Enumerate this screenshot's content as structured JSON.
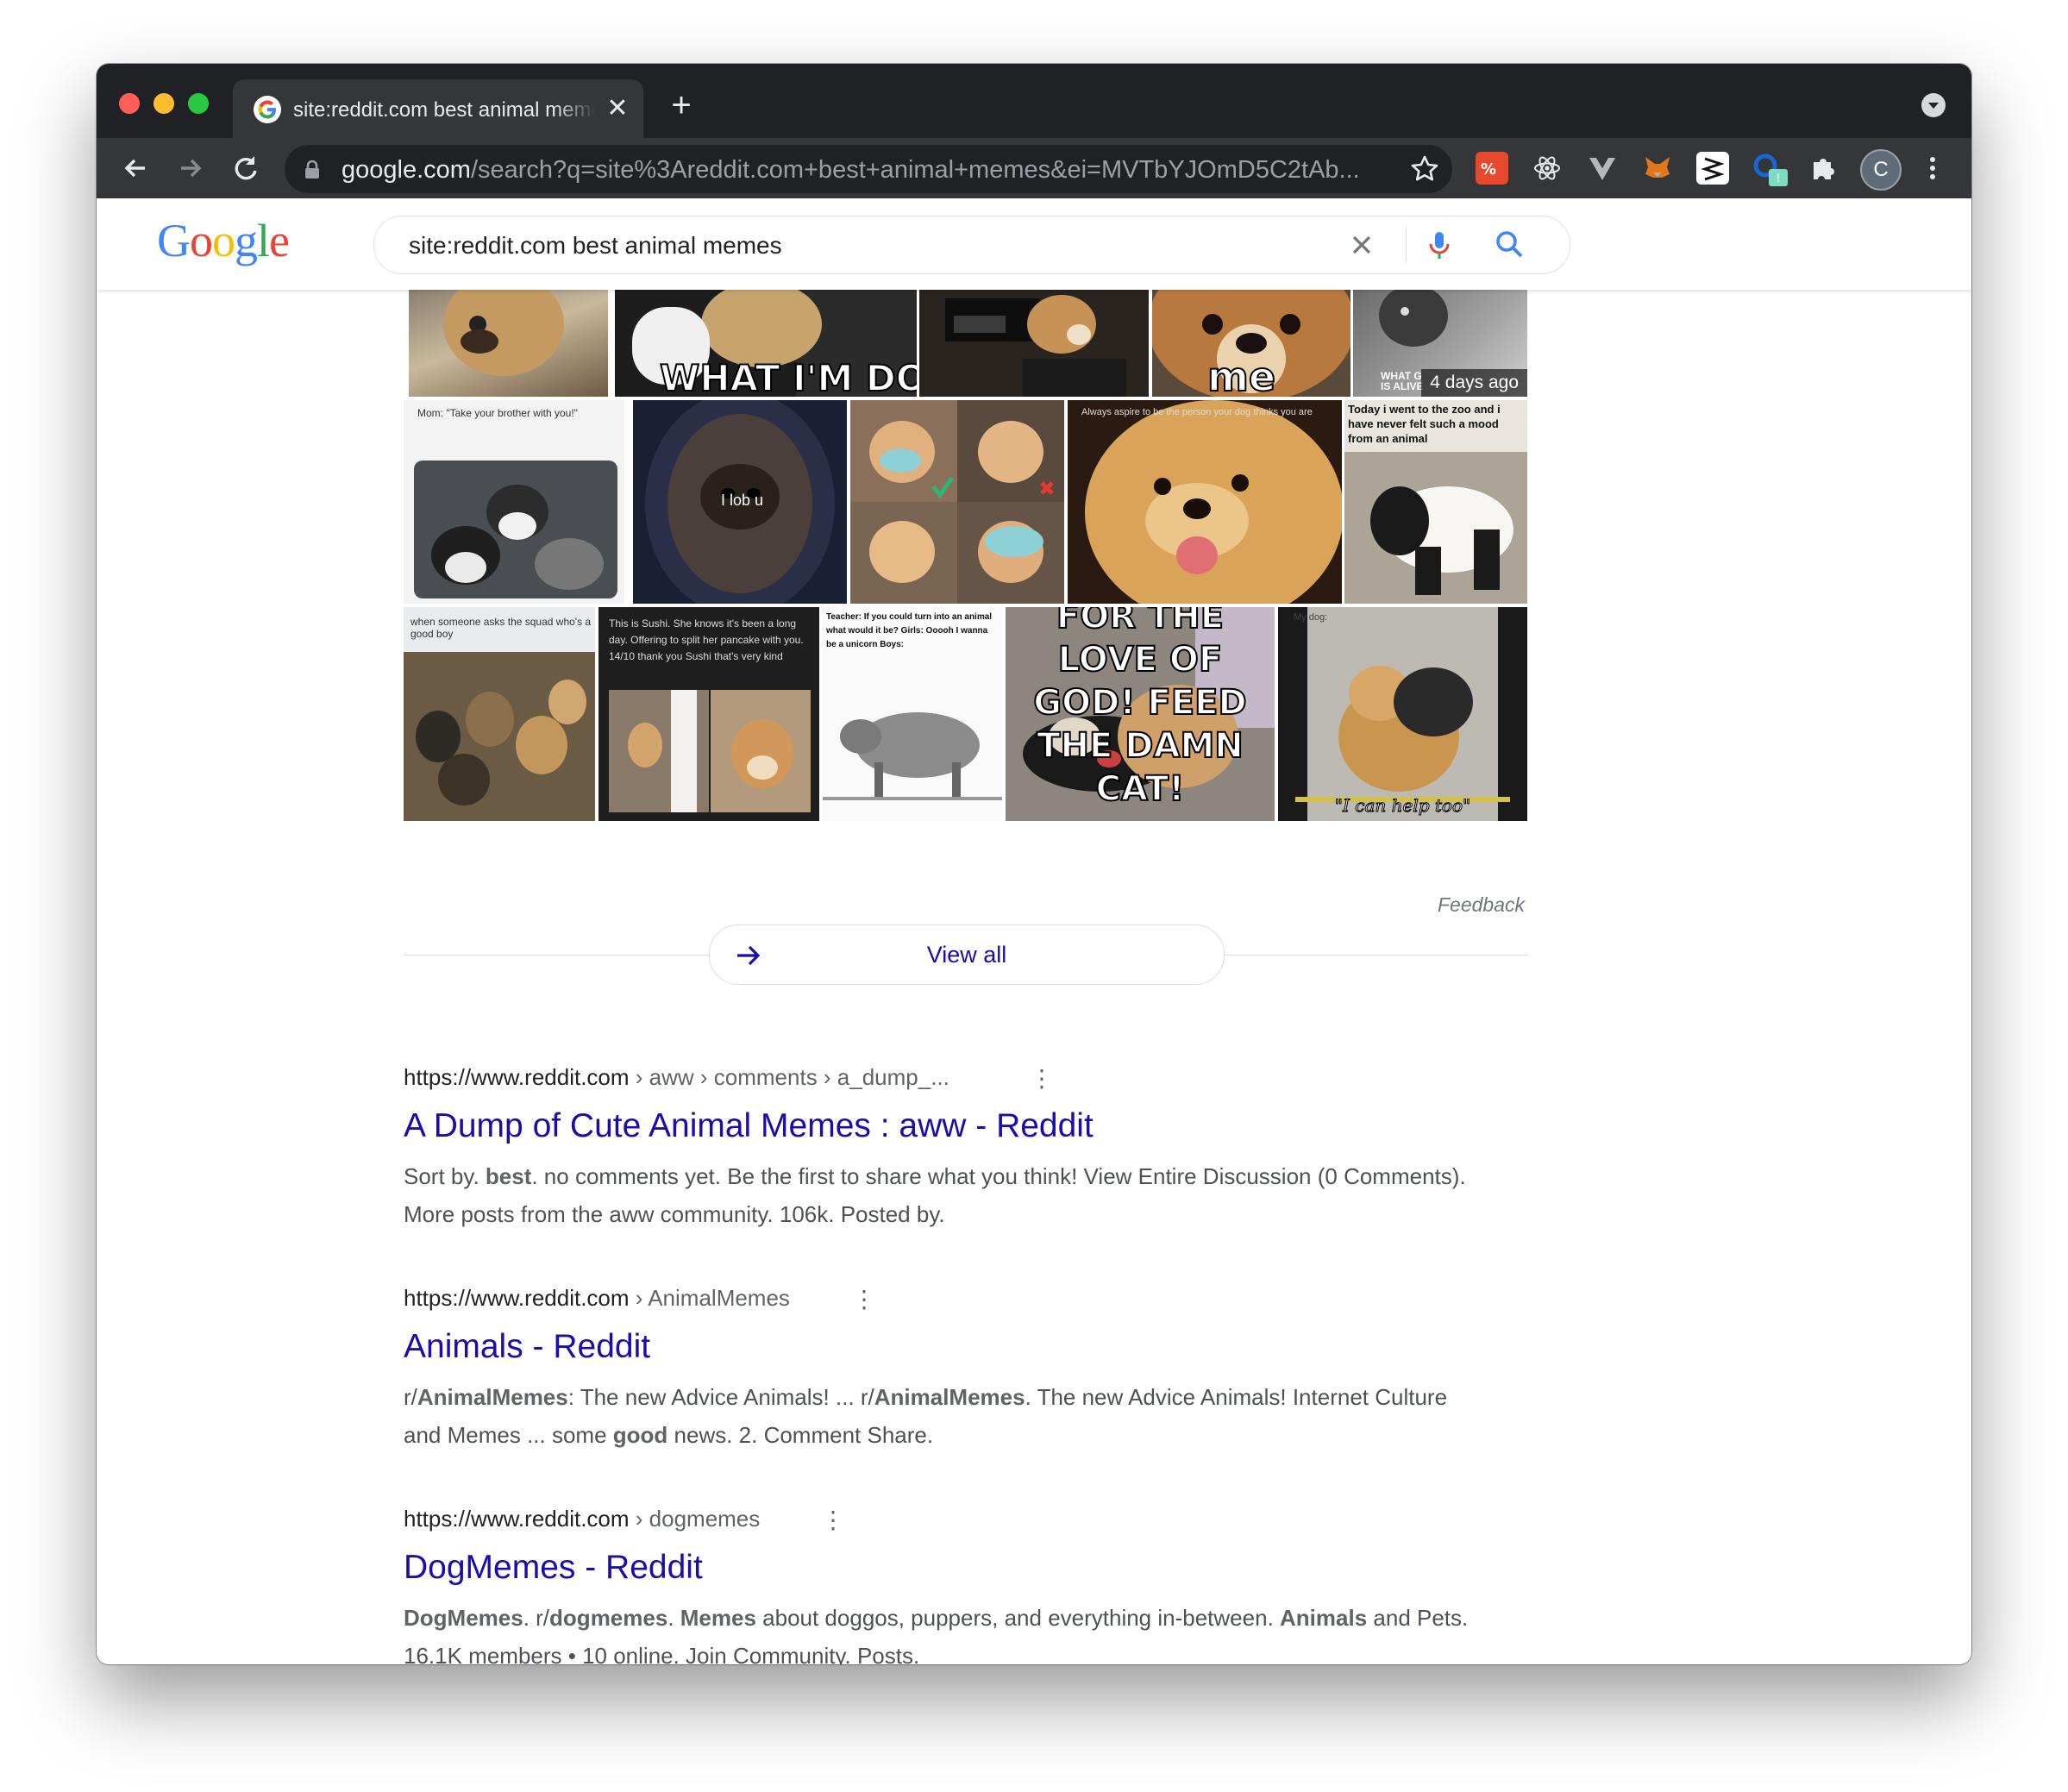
{
  "browser": {
    "tab_title": "site:reddit.com best animal memes - Google Search",
    "tab_close": "✕",
    "new_tab": "+",
    "url_host": "google.com",
    "url_path": "/search?q=site%3Areddit.com+best+animal+memes&ei=MVTbYJOmD5C2tAb...",
    "profile_initial": "C",
    "extension_badge": "!"
  },
  "google": {
    "logo_letters": [
      "G",
      "o",
      "o",
      "g",
      "l",
      "e"
    ],
    "logo_colors": [
      "#4285f4",
      "#ea4335",
      "#fbbc05",
      "#4285f4",
      "#34a853",
      "#ea4335"
    ],
    "query": "site:reddit.com best animal memes"
  },
  "images": {
    "row1": [
      {
        "caption": ""
      },
      {
        "caption": "WHAT I'M DOING"
      },
      {
        "caption": ""
      },
      {
        "caption": "me"
      },
      {
        "caption": "WHAT G IS ALIVE",
        "date": "4 days ago"
      }
    ],
    "row2": [
      {
        "caption": "Mom: \"Take your brother with you!\""
      },
      {
        "caption": "I lob u"
      },
      {
        "caption": ""
      },
      {
        "caption": "Always aspire to be the person your dog thinks you are"
      },
      {
        "caption": "Today i went to the zoo and i have never felt such a mood from an animal"
      }
    ],
    "row3": [
      {
        "caption": "when someone asks the squad who's a good boy"
      },
      {
        "caption": "This is Sushi. She knows it's been a long day. Offering to split her pancake with you. 14/10 thank you Sushi that's very kind"
      },
      {
        "caption": "Teacher: If you could turn into an animal what would it be? Girls: Ooooh I wanna be a unicorn Boys:"
      },
      {
        "caption": "FOR THE LOVE OF GOD! FEED THE DAMN CAT!"
      },
      {
        "caption": "My dog: \"I can help too\""
      }
    ],
    "feedback": "Feedback",
    "view_all": "View all"
  },
  "results": [
    {
      "site": "https://www.reddit.com",
      "path": " › aww › comments › a_dump_...",
      "title": "A Dump of Cute Animal Memes : aww - Reddit",
      "snippet_html": "Sort by. <b>best</b>. no comments yet. Be the first to share what you think! View Entire Discussion (0 Comments). More posts from the aww community. 106k. Posted by."
    },
    {
      "site": "https://www.reddit.com",
      "path": " › AnimalMemes",
      "title": "Animals - Reddit",
      "snippet_html": "r/<b>AnimalMemes</b>: The new Advice Animals! ... r/<b>AnimalMemes</b>. The new Advice Animals! Internet Culture and Memes ... some <b>good</b> news. 2. Comment Share."
    },
    {
      "site": "https://www.reddit.com",
      "path": " › dogmemes",
      "title": "DogMemes - Reddit",
      "snippet_html": "<b>DogMemes</b>. r/<b>dogmemes</b>. <b>Memes</b> about doggos, puppers, and everything in-between. <b>Animals</b> and Pets. 16.1K members • 10 online. Join Community. Posts."
    }
  ]
}
